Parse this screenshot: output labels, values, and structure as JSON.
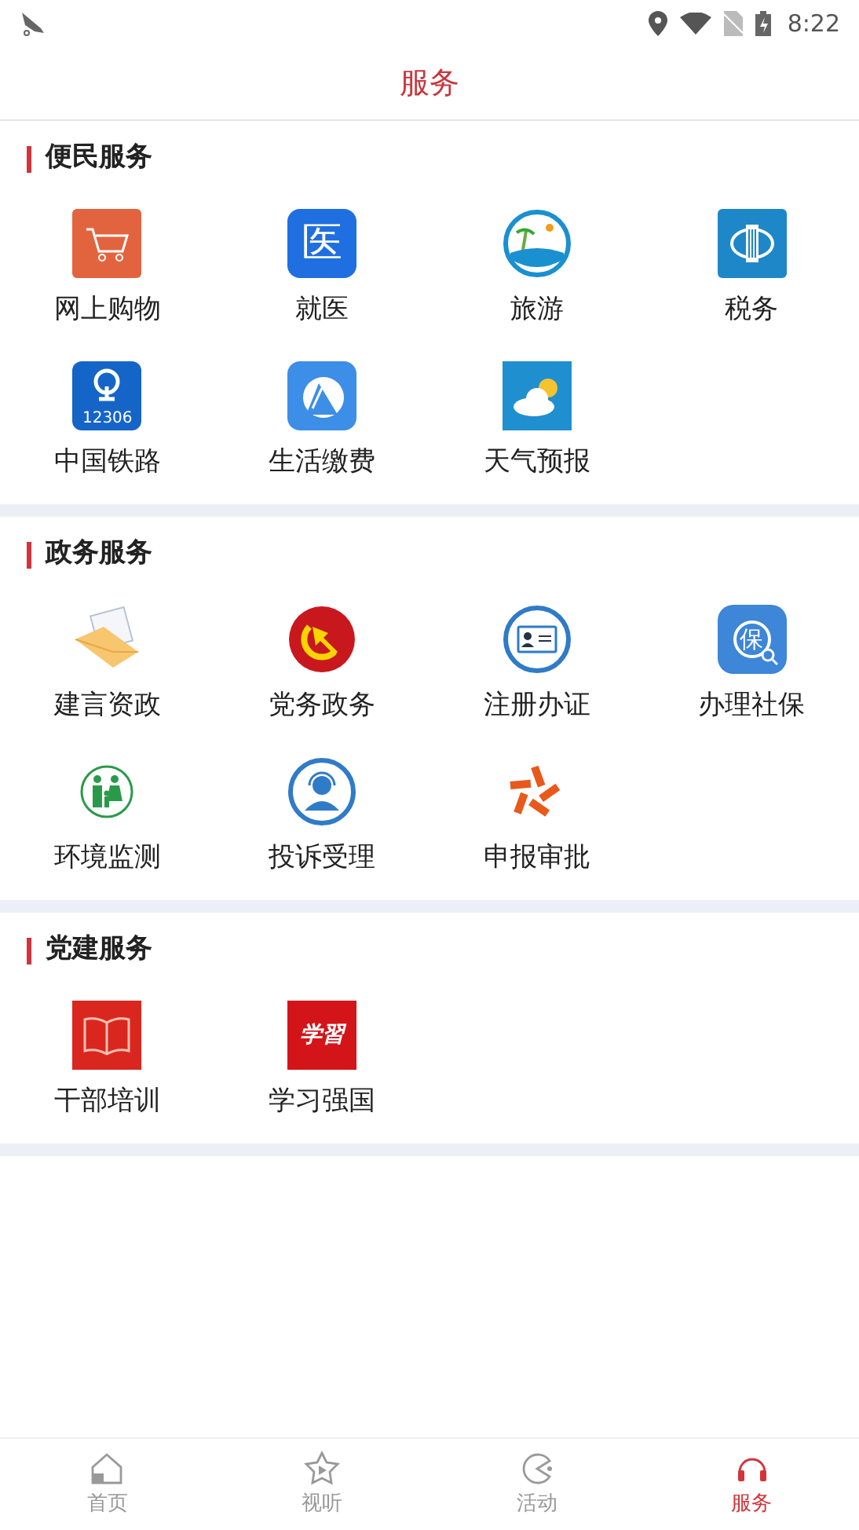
{
  "status_bar": {
    "time": "8:22"
  },
  "header": {
    "title": "服务"
  },
  "sections": [
    {
      "title": "便民服务",
      "items": [
        {
          "label": "网上购物",
          "kind": "cart"
        },
        {
          "label": "就医",
          "kind": "medical",
          "icon_text": "医"
        },
        {
          "label": "旅游",
          "kind": "beach"
        },
        {
          "label": "税务",
          "kind": "tax"
        },
        {
          "label": "中国铁路",
          "kind": "rail",
          "icon_text": "12306"
        },
        {
          "label": "生活缴费",
          "kind": "bill"
        },
        {
          "label": "天气预报",
          "kind": "weather"
        }
      ]
    },
    {
      "title": "政务服务",
      "items": [
        {
          "label": "建言资政",
          "kind": "letters"
        },
        {
          "label": "党务政务",
          "kind": "party"
        },
        {
          "label": "注册办证",
          "kind": "idcard"
        },
        {
          "label": "办理社保",
          "kind": "insurance",
          "icon_text": "保"
        },
        {
          "label": "环境监测",
          "kind": "family"
        },
        {
          "label": "投诉受理",
          "kind": "support"
        },
        {
          "label": "申报审批",
          "kind": "pinwheel"
        }
      ]
    },
    {
      "title": "党建服务",
      "items": [
        {
          "label": "干部培训",
          "kind": "book"
        },
        {
          "label": "学习强国",
          "kind": "study",
          "icon_text": "学習"
        }
      ]
    }
  ],
  "tabs": [
    {
      "label": "首页",
      "kind": "home",
      "selected": false
    },
    {
      "label": "视听",
      "kind": "star",
      "selected": false
    },
    {
      "label": "活动",
      "kind": "pacman",
      "selected": false
    },
    {
      "label": "服务",
      "kind": "service",
      "selected": true
    }
  ]
}
